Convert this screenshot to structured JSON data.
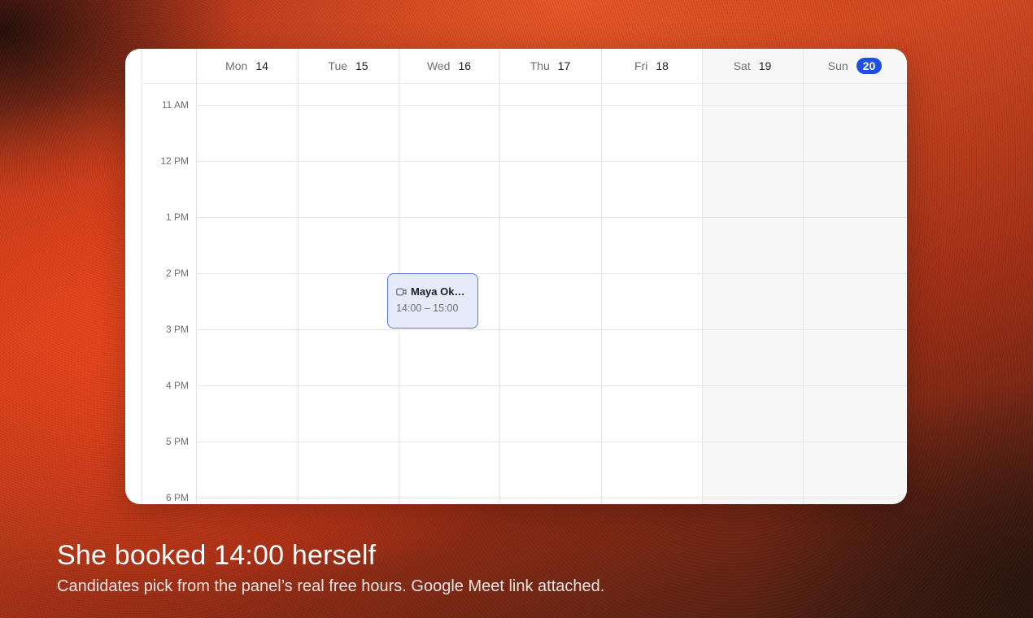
{
  "calendar": {
    "days": [
      {
        "name": "Mon",
        "num": "14",
        "today": false
      },
      {
        "name": "Tue",
        "num": "15",
        "today": false
      },
      {
        "name": "Wed",
        "num": "16",
        "today": false
      },
      {
        "name": "Thu",
        "num": "17",
        "today": false
      },
      {
        "name": "Fri",
        "num": "18",
        "today": false
      },
      {
        "name": "Sat",
        "num": "19",
        "today": false
      },
      {
        "name": "Sun",
        "num": "20",
        "today": true
      }
    ],
    "hours": [
      "11 AM",
      "12 PM",
      "1 PM",
      "2 PM",
      "3 PM",
      "4 PM",
      "5 PM",
      "6 PM"
    ],
    "event": {
      "title": "Maya Oka…",
      "time": "14:00 – 15:00",
      "icon": "video-camera-icon",
      "accent": "#5a7ae0",
      "fill": "#e6ebfb"
    },
    "today_color": "#1f4fe0"
  },
  "caption": {
    "title": "She booked 14:00 herself",
    "subtitle": "Candidates pick from the panel’s real free hours. Google Meet link attached."
  }
}
